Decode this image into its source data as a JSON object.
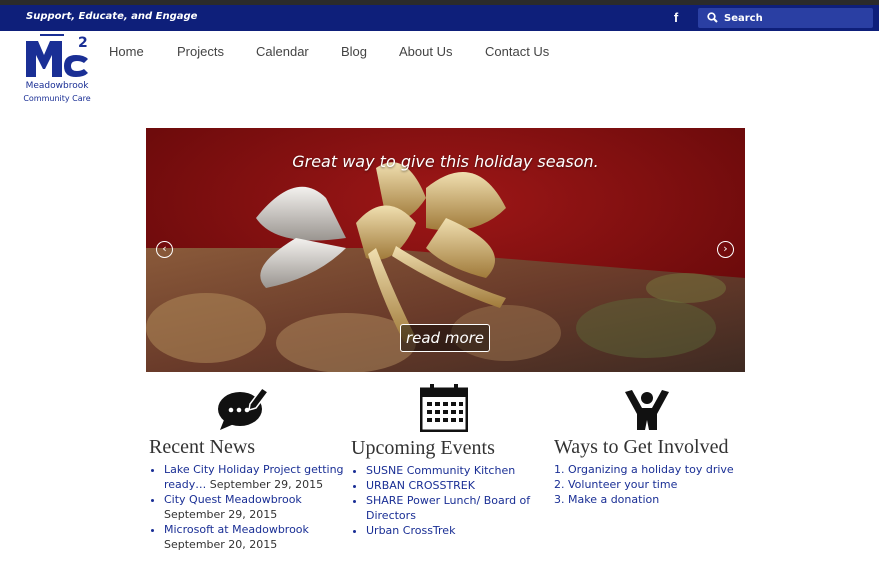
{
  "topbar": {
    "tagline": "Support, Educate, and Engage",
    "facebook_icon": "facebook-icon",
    "search_placeholder": "Search",
    "bar_color": "#0e1f7a"
  },
  "logo": {
    "line1": "Meadowbrook",
    "line2": "Community Care",
    "brand_color": "#1a2f95"
  },
  "nav": {
    "items": [
      "Home",
      "Projects",
      "Calendar",
      "Blog",
      "About Us",
      "Contact Us"
    ]
  },
  "slider": {
    "caption": "Great way to give this holiday season.",
    "read_more": "read more",
    "prev_icon": "chevron-left-icon",
    "next_icon": "chevron-right-icon"
  },
  "news": {
    "icon": "speech-bubble-pencil-icon",
    "title": "Recent News",
    "items": [
      {
        "link": "Lake City Holiday Project getting ready…",
        "date": "September 29, 2015"
      },
      {
        "link": "City Quest Meadowbrook",
        "date": "September 29, 2015"
      },
      {
        "link": "Microsoft at Meadowbrook",
        "date": "September 20, 2015"
      }
    ]
  },
  "events": {
    "icon": "calendar-icon",
    "title": "Upcoming Events",
    "items": [
      "SUSNE Community Kitchen",
      "URBAN CROSSTREK",
      "SHARE Power Lunch/ Board of Directors",
      "Urban CrossTrek"
    ]
  },
  "involved": {
    "icon": "person-raising-hands-icon",
    "title": "Ways to Get Involved",
    "items": [
      "1. Organizing a holiday toy drive",
      "2. Volunteer your time",
      "3. Make a donation"
    ]
  }
}
